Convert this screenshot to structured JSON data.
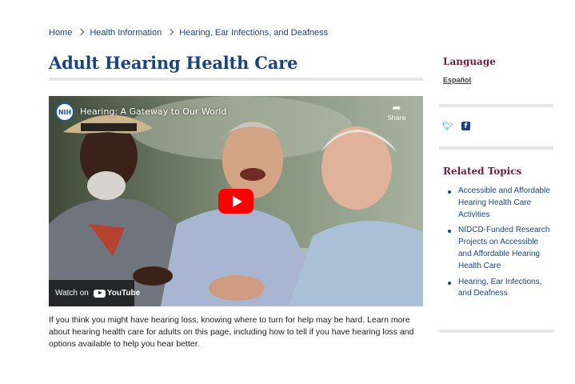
{
  "breadcrumb": {
    "items": [
      "Home",
      "Health Information",
      "Hearing, Ear Infections, and Deafness"
    ]
  },
  "page": {
    "title": "Adult Hearing Health Care",
    "intro": "If you think you might have hearing loss, knowing where to turn for help may be hard. Learn more about hearing health care for adults on this page, including how to tell if you have hearing loss and options available to help you hear better."
  },
  "video": {
    "channel_logo": "NIH",
    "title": "Hearing: A Gateway to Our World",
    "share_label": "Share",
    "watch_on_label": "Watch on",
    "youtube_label": "YouTube",
    "play_icon": "play-icon",
    "share_icon": "share-arrow-icon"
  },
  "sidebar": {
    "language_heading": "Language",
    "language_link": "Español",
    "social": {
      "twitter_icon": "twitter-icon",
      "facebook_icon": "facebook-icon",
      "facebook_glyph": "f"
    },
    "related_heading": "Related Topics",
    "related_topics": [
      "Accessible and Affordable Hearing Health Care Activities",
      "NIDCD-Funded Research Projects on Accessible and Affordable Hearing Health Care",
      "Hearing, Ear Infections, and Deafness"
    ]
  },
  "colors": {
    "link": "#1a4480",
    "sidebar_heading": "#6b1f3f",
    "youtube_red": "#ff0000"
  }
}
